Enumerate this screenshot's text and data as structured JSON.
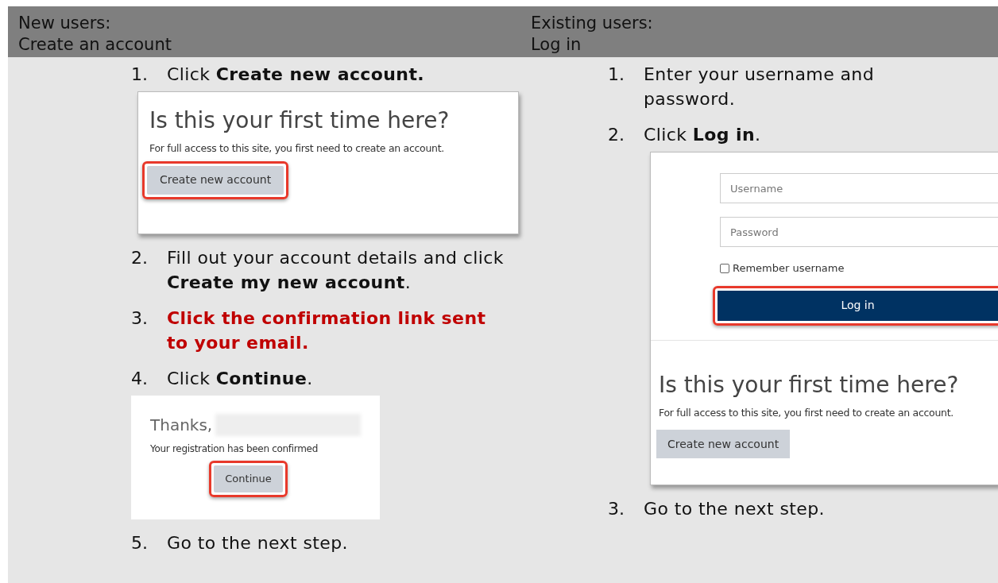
{
  "columns": [
    {
      "heading": [
        "New users:",
        "Create an account"
      ],
      "steps": [
        {
          "number": "1.",
          "text": "Click **Create new account.**",
          "emphasis": false,
          "screenshot": {
            "kind": "first_time",
            "title": "Is this your first time here?",
            "text": "For full access to this site, you first need to create an account.",
            "button": "Create new account",
            "button_highlighted": true
          }
        },
        {
          "number": "2.",
          "text": "Fill out your account details and click **Create my new account**.",
          "emphasis": false
        },
        {
          "number": "3.",
          "text": "Click the confirmation link sent to your email.",
          "emphasis": true
        },
        {
          "number": "4.",
          "text": "Click **Continue**.",
          "emphasis": false,
          "screenshot": {
            "kind": "thanks",
            "title": "Thanks,",
            "text": "Your registration has been confirmed",
            "button": "Continue",
            "button_highlighted": true
          }
        },
        {
          "number": "5.",
          "text": "Go to the next step.",
          "emphasis": false
        }
      ]
    },
    {
      "heading": [
        "Existing users:",
        "Log in"
      ],
      "steps": [
        {
          "number": "1.",
          "text": "Enter your username and password.",
          "emphasis": false
        },
        {
          "number": "2.",
          "text": "Click **Log in**.",
          "emphasis": false,
          "screenshot": {
            "kind": "login",
            "username_placeholder": "Username",
            "password_placeholder": "Password",
            "remember": {
              "label": "Remember username",
              "checked": false
            },
            "button": "Log in",
            "button_highlighted": true,
            "signup": {
              "title": "Is this your first time here?",
              "text": "For full access to this site, you first need to create an account.",
              "button": "Create new account",
              "button_highlighted": false
            }
          }
        },
        {
          "number": "3.",
          "text": "Go to the next step.",
          "emphasis": false
        }
      ]
    }
  ]
}
